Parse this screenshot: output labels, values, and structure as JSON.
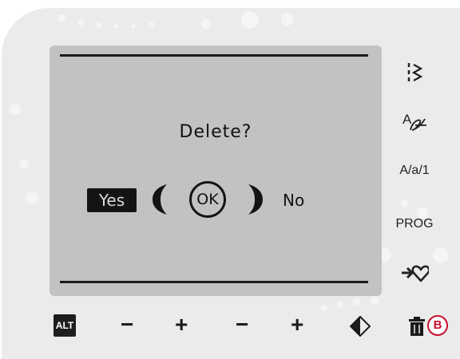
{
  "screen": {
    "message": "Delete?",
    "yes_label": "Yes",
    "ok_label": "OK",
    "no_label": "No"
  },
  "side_buttons": {
    "stitch_icon": "stitch-menu-icon",
    "font_icon": "font-menu-icon",
    "case_label": "A/a/1",
    "prog_label": "PROG",
    "favorite_icon": "save-to-favorites-icon"
  },
  "bottom_buttons": {
    "alt_label": "ALT",
    "minus_1": "−",
    "plus_1": "+",
    "minus_2": "−",
    "plus_2": "+",
    "mirror_icon": "mirror-icon",
    "delete_icon": "trash-icon",
    "callout_label": "B"
  },
  "colors": {
    "panel": "#ebebeb",
    "lcd_background": "#c2c2c2",
    "lcd_ink": "#141414",
    "callout_red": "#c8102e"
  }
}
